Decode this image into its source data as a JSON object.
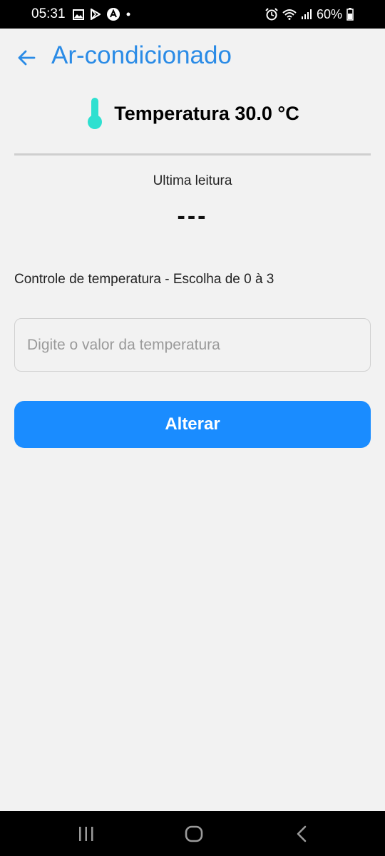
{
  "status_bar": {
    "time": "05:31",
    "battery": "60%",
    "left_icons": [
      "gallery-icon",
      "play-store-icon",
      "app-icon",
      "dot-icon"
    ],
    "right_icons": [
      "alarm-icon",
      "wifi-icon",
      "signal-icon",
      "battery-icon"
    ]
  },
  "header": {
    "title": "Ar-condicionado",
    "back_icon": "arrow-left-icon"
  },
  "temperature": {
    "icon": "thermometer-icon",
    "label": "Temperatura 30.0 °C"
  },
  "reading": {
    "label": "Ultima leitura",
    "value": "---"
  },
  "control": {
    "label": "Controle de temperatura - Escolha de 0 à 3",
    "input_placeholder": "Digite o valor da temperatura",
    "input_value": "",
    "button_label": "Alterar"
  },
  "nav_bar": {
    "items": [
      "recent-apps-icon",
      "home-icon",
      "back-icon"
    ]
  },
  "colors": {
    "accent": "#2a8be6",
    "button": "#1a8cff",
    "thermometer": "#2ee0d0",
    "background": "#f2f2f2"
  }
}
